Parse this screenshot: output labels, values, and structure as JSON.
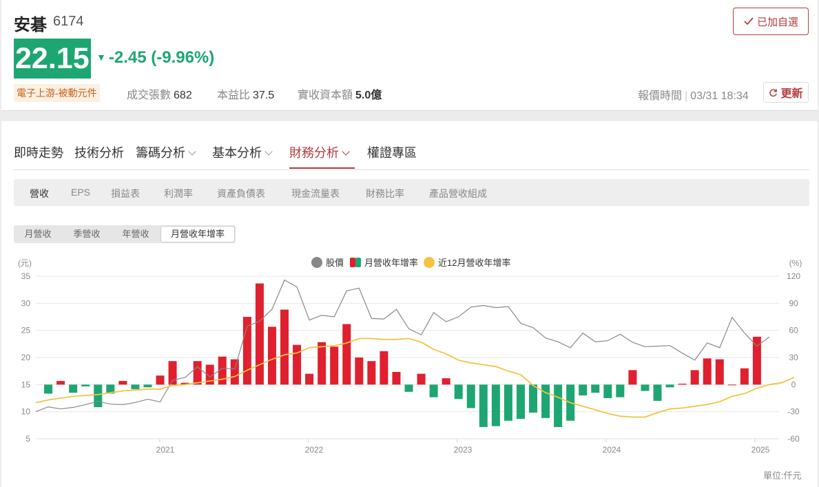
{
  "stock": {
    "name": "安碁",
    "code": "6174",
    "price": "22.15",
    "change": "-2.45 (-9.96%)",
    "change_arrow": "▼",
    "industry": "電子上游-被動元件",
    "volume_label": "成交張數",
    "volume": "682",
    "pe_label": "本益比",
    "pe": "37.5",
    "capital_label": "實收資本額",
    "capital": "5.0億",
    "watch_label": "已加自選",
    "quote_time_label": "報價時間",
    "quote_time": "03/31 18:34",
    "refresh_label": "更新",
    "colors": {
      "down": "#1ea672",
      "up": "#e0202e",
      "accent": "#b43a3a"
    }
  },
  "tabs": [
    "即時走勢",
    "技術分析",
    "籌碼分析",
    "基本分析",
    "財務分析",
    "權證專區"
  ],
  "active_tab": "財務分析",
  "subtabs": [
    "營收",
    "EPS",
    "損益表",
    "利潤率",
    "資產負債表",
    "現金流量表",
    "財務比率",
    "產品營收組成"
  ],
  "active_subtab": "營收",
  "segments": [
    "月營收",
    "季營收",
    "年營收",
    "月營收年增率"
  ],
  "active_segment": "月營收年增率",
  "unit_text": "單位:仟元",
  "chart_data": {
    "type": "bar+line",
    "legend": [
      "股價",
      "月營收年增率",
      "近12月營收年增率"
    ],
    "y_left": {
      "label": "(元)",
      "range": [
        5,
        35
      ],
      "ticks": [
        5,
        10,
        15,
        20,
        25,
        30,
        35
      ]
    },
    "y_right": {
      "label": "(%)",
      "range": [
        -60,
        120
      ],
      "ticks": [
        -60,
        -30,
        0,
        30,
        60,
        90,
        120
      ]
    },
    "x_ticks": [
      "2021",
      "2022",
      "2023",
      "2024",
      "2025"
    ],
    "x_start": "2020-03",
    "colors": {
      "price": "#888888",
      "yoy_up": "#e0202e",
      "yoy_down": "#1ea672",
      "yoy12": "#f5c242"
    },
    "series": [
      {
        "name": "股價",
        "axis": "left",
        "values": [
          10.0,
          10.9,
          10.5,
          10.8,
          11.3,
          11.9,
          11.4,
          11.3,
          11.7,
          12.3,
          11.8,
          15.8,
          16.3,
          18.3,
          16.4,
          18.0,
          17.9,
          25.8,
          26.7,
          28.9,
          34.3,
          33.0,
          26.9,
          27.8,
          27.5,
          32.3,
          32.8,
          27.2,
          27.1,
          28.9,
          25.3,
          24.2,
          28.3,
          26.6,
          27.5,
          29.3,
          29.6,
          29.2,
          29.4,
          26.3,
          25.5,
          23.6,
          22.9,
          21.8,
          24.5,
          22.9,
          23.1,
          24.3,
          22.8,
          22.0,
          22.1,
          22.2,
          20.8,
          19.5,
          22.7,
          21.8,
          27.4,
          24.5,
          22.1,
          23.8
        ]
      },
      {
        "name": "月營收年增率",
        "axis": "right",
        "values": [
          -10,
          4,
          -9,
          -2,
          -25,
          -10,
          4,
          -5,
          -3,
          10,
          26,
          2,
          26,
          22,
          31,
          28,
          75,
          112,
          64,
          83,
          44,
          12,
          47,
          42,
          67,
          30,
          26,
          37,
          14,
          -8,
          12,
          -14,
          7,
          -16,
          -26,
          -47,
          -46,
          -40,
          -38,
          -31,
          -37,
          -47,
          -40,
          -12,
          -9,
          -15,
          -14,
          16,
          -7,
          -18,
          -3,
          1,
          16,
          29,
          28,
          0,
          18,
          53
        ]
      },
      {
        "name": "近12月營收年增率",
        "axis": "right",
        "values": [
          -20,
          -17,
          -15,
          -13,
          -12,
          -11,
          -9,
          -7,
          -6,
          -5,
          -5,
          -1,
          0,
          2,
          4,
          6,
          9,
          16,
          22,
          28,
          33,
          35,
          41,
          42,
          43,
          46,
          51,
          51,
          50,
          50,
          51,
          47,
          39,
          34,
          27,
          24,
          22,
          20,
          15,
          11,
          -1,
          -9,
          -14,
          -20,
          -24,
          -28,
          -32,
          -35,
          -36,
          -36,
          -31,
          -27,
          -26,
          -24,
          -22,
          -19,
          -13,
          -10,
          -4,
          0,
          2,
          8
        ]
      }
    ]
  }
}
